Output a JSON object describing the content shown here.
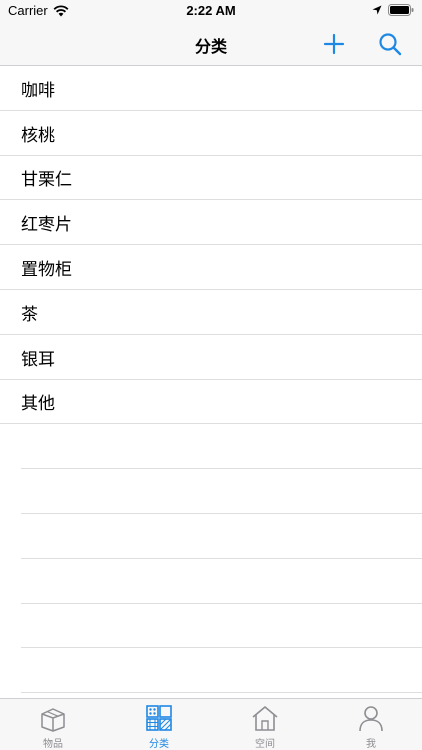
{
  "status_bar": {
    "carrier": "Carrier",
    "time": "2:22 AM",
    "icons": [
      "wifi-icon",
      "location-arrow-icon",
      "battery-icon"
    ]
  },
  "nav": {
    "title": "分类",
    "icons": [
      "add-icon",
      "search-icon"
    ],
    "accent_color": "#1e88e5"
  },
  "categories": [
    {
      "label": "咖啡"
    },
    {
      "label": "核桃"
    },
    {
      "label": "甘栗仁"
    },
    {
      "label": "红枣片"
    },
    {
      "label": "置物柜"
    },
    {
      "label": "茶"
    },
    {
      "label": "银耳"
    },
    {
      "label": "其他"
    }
  ],
  "tabs": [
    {
      "label": "物品",
      "icon": "box-icon",
      "active": false
    },
    {
      "label": "分类",
      "icon": "category-grid-icon",
      "active": true
    },
    {
      "label": "空间",
      "icon": "house-icon",
      "active": false
    },
    {
      "label": "我",
      "icon": "person-icon",
      "active": false
    }
  ]
}
